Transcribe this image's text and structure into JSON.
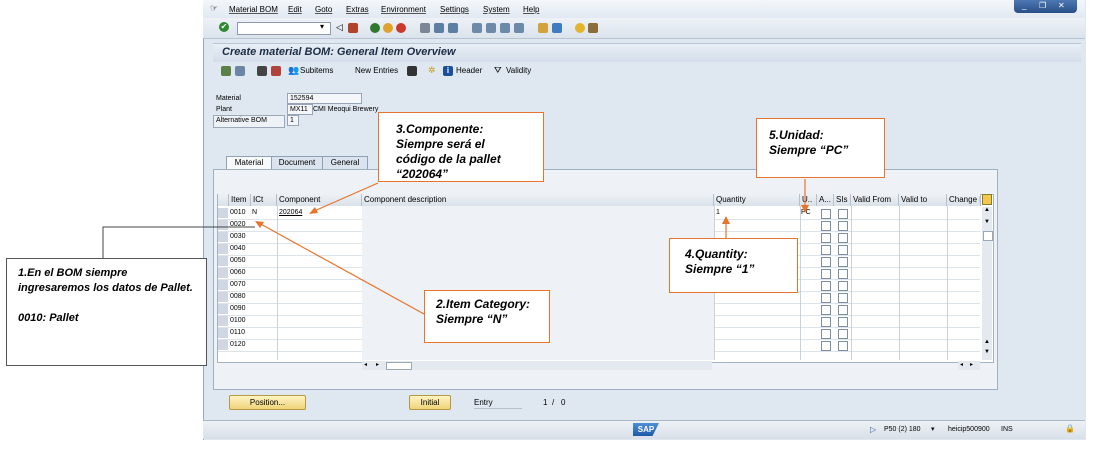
{
  "menu": [
    "Material BOM",
    "Edit",
    "Goto",
    "Extras",
    "Environment",
    "Settings",
    "System",
    "Help"
  ],
  "title": "Create material BOM: General Item Overview",
  "app_toolbar": {
    "subitems": "Subitems",
    "new_entries": "New Entries",
    "header": "Header",
    "validity": "Validity"
  },
  "header_fields": {
    "material_label": "Material",
    "material_value": "152594",
    "plant_label": "Plant",
    "plant_value": "MX11",
    "plant_desc": "CMI Meoqui Brewery",
    "altbom_label": "Alternative BOM",
    "altbom_value": "1"
  },
  "tabs": [
    "Material",
    "Document",
    "General"
  ],
  "table": {
    "columns": [
      "Item",
      "ICt",
      "Component",
      "Component description",
      "Quantity",
      "U..",
      "A...",
      "SIs",
      "Valid From",
      "Valid to",
      "Change N"
    ],
    "rows": [
      {
        "item": "0010",
        "ict": "N",
        "component": "202064",
        "quantity": "1",
        "unit": "PC"
      },
      {
        "item": "0020"
      },
      {
        "item": "0030"
      },
      {
        "item": "0040"
      },
      {
        "item": "0050"
      },
      {
        "item": "0060"
      },
      {
        "item": "0070"
      },
      {
        "item": "0080"
      },
      {
        "item": "0090"
      },
      {
        "item": "0100"
      },
      {
        "item": "0110"
      },
      {
        "item": "0120"
      }
    ]
  },
  "bottom": {
    "position": "Position...",
    "initial": "Initial",
    "entry_label": "Entry",
    "entry_count": "1",
    "entry_sep": "/",
    "entry_total": "0"
  },
  "status": {
    "system": "P50 (2) 180",
    "server": "heicip500900",
    "mode": "INS",
    "sap": "SAP"
  },
  "callouts": {
    "c1": "1.En el BOM siempre ingresaremos los datos de Pallet.",
    "c1b": "0010: Pallet",
    "c2a": "2.Item Category:",
    "c2b": "Siempre “N”",
    "c3a": "3.Componente:",
    "c3b": "Siempre será el código de la pallet “202064”",
    "c4a": "4.Quantity:",
    "c4b": "Siempre “1”",
    "c5a": "5.Unidad:",
    "c5b": "Siempre “PC”"
  }
}
